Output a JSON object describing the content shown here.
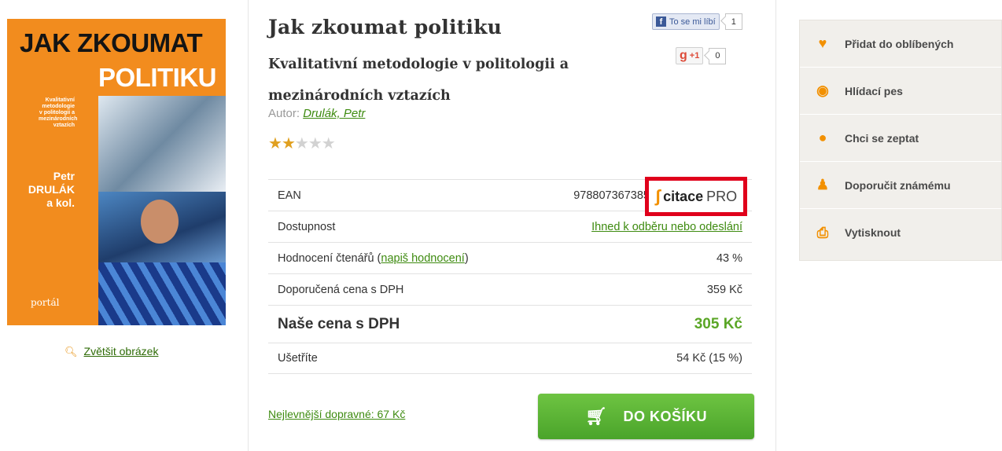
{
  "cover": {
    "title_line1": "JAK ZKOUMAT",
    "title_line2": "POLITIKU",
    "subtitle": "Kvalitativní metodologie v politologii a mezinárodních vztazích",
    "author_first": "Petr",
    "author_last": "DRULÁK",
    "author_rest": "a kol.",
    "publisher": "portál"
  },
  "zoom_link": "Zvětšit obrázek",
  "book": {
    "title": "Jak zkoumat politiku",
    "subtitle": "Kvalitativní metodologie v politologii a mezinárodních vztazích",
    "author_label": "Autor:",
    "author_name": "Drulák, Petr",
    "rating_stars": 2,
    "rating_max": 5
  },
  "social": {
    "fb_label": "To se mi líbí",
    "fb_count": "1",
    "gplus_label": "+1",
    "gplus_count": "0"
  },
  "info": {
    "ean_label": "EAN",
    "ean_value": "978807367385",
    "availability_label": "Dostupnost",
    "availability_value": "Ihned k odběru nebo odeslání",
    "rating_label_pre": "Hodnocení čtenářů (",
    "rating_link": "napiš hodnocení",
    "rating_label_post": ")",
    "rating_value": "43 %",
    "rrp_label": "Doporučená cena s DPH",
    "rrp_value": "359 Kč",
    "price_label": "Naše cena s DPH",
    "price_value": "305 Kč",
    "save_label": "Ušetříte",
    "save_value": "54 Kč (15 %)"
  },
  "citace": {
    "brand": "citace",
    "suffix": "PRO"
  },
  "shipping_link": "Nejlevnější dopravné: 67 Kč",
  "cart_label": "DO KOŠÍKU",
  "sidebar": {
    "items": [
      {
        "label": "Přidat do oblíbených",
        "icon": "heart-icon"
      },
      {
        "label": "Hlídací pes",
        "icon": "eye-icon"
      },
      {
        "label": "Chci se zeptat",
        "icon": "speech-bubble-icon"
      },
      {
        "label": "Doporučit známému",
        "icon": "person-icon"
      },
      {
        "label": "Vytisknout",
        "icon": "printer-icon"
      }
    ]
  },
  "colors": {
    "accent": "#f29000",
    "green": "#5aa626",
    "link": "#3e8b10",
    "highlight": "#e0001b"
  }
}
